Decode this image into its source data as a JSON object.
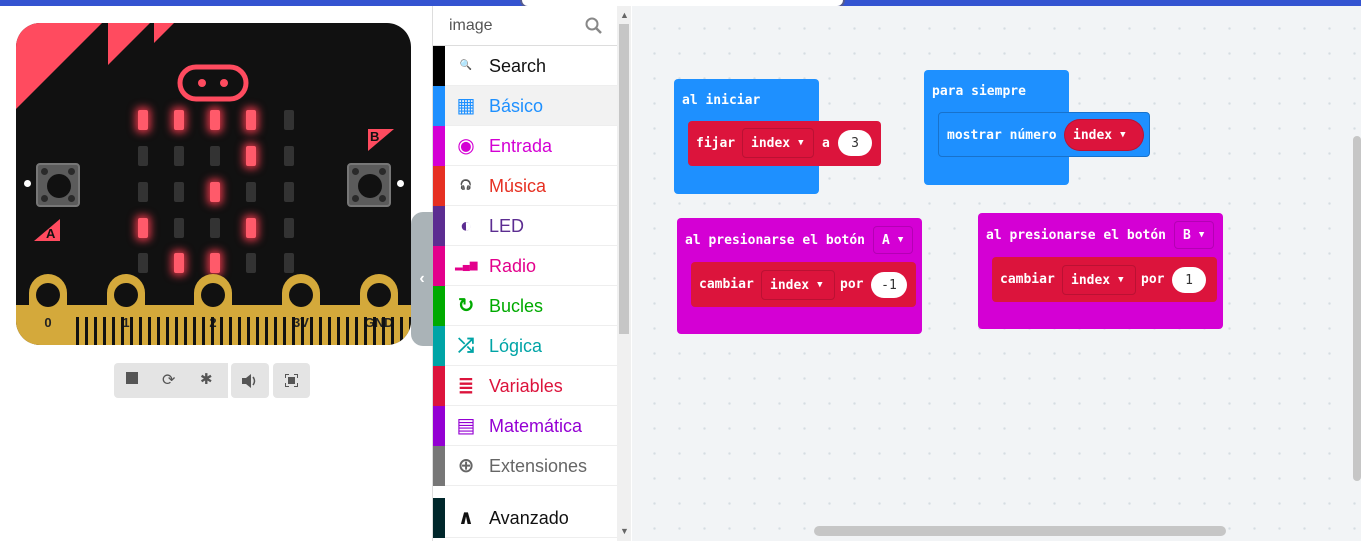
{
  "colors": {
    "basic": "#1e90ff",
    "input": "#d400d4",
    "music": "#e63022",
    "led": "#5c2d91",
    "radio": "#e3008c",
    "loops": "#00aa00",
    "logic": "#00a4a6",
    "variables": "#dc143c",
    "math": "#9400d3",
    "extensions": "#777777",
    "advanced": "#00272b"
  },
  "board": {
    "button_a": "A",
    "button_b": "B",
    "pins": [
      "0",
      "1",
      "2",
      "3V",
      "GND"
    ],
    "led_matrix": [
      [
        1,
        1,
        1,
        1,
        0
      ],
      [
        0,
        0,
        0,
        1,
        0
      ],
      [
        0,
        0,
        1,
        0,
        0
      ],
      [
        1,
        0,
        0,
        1,
        0
      ],
      [
        0,
        1,
        1,
        0,
        0
      ]
    ]
  },
  "sim_controls": [
    {
      "name": "stop-icon",
      "glyph": "■"
    },
    {
      "name": "restart-icon",
      "glyph": "⟳"
    },
    {
      "name": "debug-icon",
      "glyph": "✱"
    },
    {
      "name": "mute-icon",
      "glyph": "🔊"
    },
    {
      "name": "fullscreen-icon",
      "glyph": "⛶"
    }
  ],
  "toolbox": {
    "search_value": "image",
    "categories": [
      {
        "label": "Search",
        "icon": "search-icon",
        "glyph": "🔍",
        "color": "#000000",
        "text_color": "#111111"
      },
      {
        "label": "Básico",
        "icon": "grid-icon",
        "glyph": "▦",
        "color": "#1e90ff",
        "text_color": "#1e90ff"
      },
      {
        "label": "Entrada",
        "icon": "target-icon",
        "glyph": "◉",
        "color": "#d400d4",
        "text_color": "#d400d4"
      },
      {
        "label": "Música",
        "icon": "headphones-icon",
        "glyph": "🎧",
        "color": "#e63022",
        "text_color": "#e63022"
      },
      {
        "label": "LED",
        "icon": "toggle-icon",
        "glyph": "◐",
        "color": "#5c2d91",
        "text_color": "#5c2d91"
      },
      {
        "label": "Radio",
        "icon": "signal-icon",
        "glyph": "▂▄▆",
        "color": "#e3008c",
        "text_color": "#e3008c"
      },
      {
        "label": "Bucles",
        "icon": "loop-icon",
        "glyph": "↻",
        "color": "#00aa00",
        "text_color": "#00aa00"
      },
      {
        "label": "Lógica",
        "icon": "shuffle-icon",
        "glyph": "⤮",
        "color": "#00a4a6",
        "text_color": "#00a4a6"
      },
      {
        "label": "Variables",
        "icon": "list-icon",
        "glyph": "≣",
        "color": "#dc143c",
        "text_color": "#dc143c"
      },
      {
        "label": "Matemática",
        "icon": "calculator-icon",
        "glyph": "▤",
        "color": "#9400d3",
        "text_color": "#9400d3"
      },
      {
        "label": "Extensiones",
        "icon": "plus-circle-icon",
        "glyph": "⊕",
        "color": "#777777",
        "text_color": "#666666"
      },
      {
        "label": "Avanzado",
        "icon": "chevron-up-icon",
        "glyph": "∧",
        "color": "#00272b",
        "text_color": "#111111"
      }
    ]
  },
  "blocks": {
    "on_start": {
      "label": "al iniciar",
      "set": "fijar",
      "var": "index",
      "to": "a",
      "value": "3"
    },
    "forever": {
      "label": "para siempre",
      "show": "mostrar número",
      "var": "index"
    },
    "button_a": {
      "label": "al presionarse el botón",
      "button": "A",
      "change": "cambiar",
      "var": "index",
      "by": "por",
      "value": "-1"
    },
    "button_b": {
      "label": "al presionarse el botón",
      "button": "B",
      "change": "cambiar",
      "var": "index",
      "by": "por",
      "value": "1"
    }
  }
}
